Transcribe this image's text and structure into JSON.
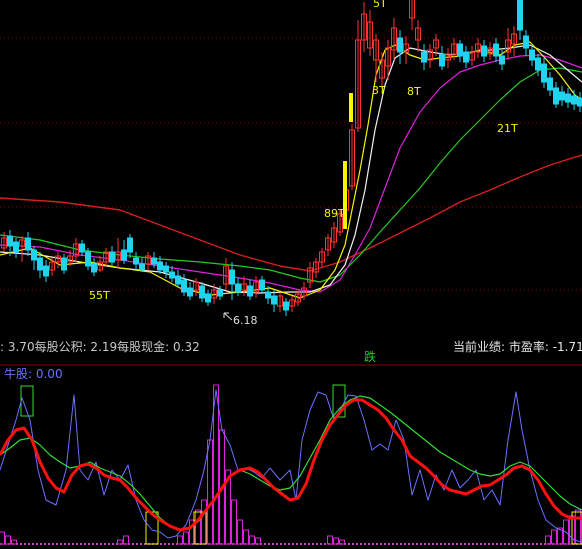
{
  "colors": {
    "background": "#000000",
    "grid": "#8b0000",
    "up": "#ff3333",
    "down": "#22d3ee",
    "ma_red": "#d21f1f",
    "ma_green": "#22cc22",
    "ma_magenta": "#dd22dd",
    "ma_white": "#f2f2f2",
    "ma_yellow": "#f5f500",
    "label_yellow": "#f5f500",
    "info_text": "#c8c8c8",
    "osc_blue": "#6b70ff",
    "osc_red": "#ff1010",
    "osc_green": "#33dd33",
    "osc_magenta": "#dd22dd",
    "osc_box_green": "#33dd33",
    "osc_box_yellow": "#f5f500",
    "dash_magenta": "#ff66ff"
  },
  "main_labels": {
    "label_5t": "5T",
    "label_3t": "3T",
    "label_8t": "8T",
    "label_21t": "21T",
    "label_89t": "89T",
    "label_55t": "55T",
    "low_mark": "6.18"
  },
  "info_bar": {
    "left": ": 3.70每股公积: 2.19每股现金: 0.32",
    "right": "当前业绩: 市盈率: -1.71",
    "center_mark": "跌"
  },
  "indicator": {
    "title": "牛股: 0.00"
  }
}
